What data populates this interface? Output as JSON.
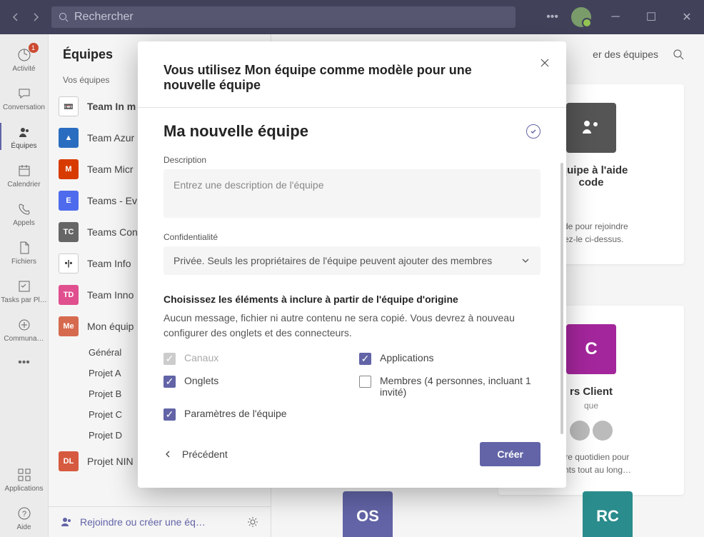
{
  "titlebar": {
    "search_placeholder": "Rechercher"
  },
  "rail": {
    "items": [
      {
        "label": "Activité",
        "name": "activity",
        "badge": "1"
      },
      {
        "label": "Conversation",
        "name": "chat"
      },
      {
        "label": "Équipes",
        "name": "teams",
        "active": true
      },
      {
        "label": "Calendrier",
        "name": "calendar"
      },
      {
        "label": "Appels",
        "name": "calls"
      },
      {
        "label": "Fichiers",
        "name": "files"
      },
      {
        "label": "Tasks par Pl…",
        "name": "tasks"
      },
      {
        "label": "Communa…",
        "name": "communa"
      }
    ],
    "apps": "Applications",
    "help": "Aide"
  },
  "panel": {
    "header": "Équipes",
    "sub": "Vos équipes",
    "teams": [
      {
        "label": "Team In m",
        "avatar": "📼",
        "color": "#fff",
        "bold": true
      },
      {
        "label": "Team Azur",
        "avatar": "▲",
        "color": "#2a6dc0"
      },
      {
        "label": "Team Micr",
        "avatar": "M",
        "color": "#d83b01"
      },
      {
        "label": "Teams - Ev",
        "avatar": "E",
        "color": "#4f6bed"
      },
      {
        "label": "Teams Con",
        "avatar": "TC",
        "color": "#666"
      },
      {
        "label": "Team Info",
        "avatar": "•|•",
        "color": "#fff"
      },
      {
        "label": "Team Inno",
        "avatar": "TD",
        "color": "#e04f8e"
      },
      {
        "label": "Mon équip",
        "avatar": "Me",
        "color": "#d66a4f"
      }
    ],
    "channels": [
      "Général",
      "Projet A",
      "Projet B",
      "Projet C",
      "Projet D"
    ],
    "extra_team": {
      "label": "Projet NIN",
      "avatar": "DL",
      "color": "#d65a3f"
    },
    "footer": "Rejoindre ou créer une éq…"
  },
  "content": {
    "manage": "er des équipes",
    "card1": {
      "title": "équipe à l'aide\ncode",
      "desc": "code pour rejoindre\ntrez-le ci-dessus."
    },
    "card2": {
      "avatar": "C",
      "title": "rs Client",
      "sub": "que",
      "desc": "notre quotidien pour\nclients tout au long…"
    },
    "card3": {
      "avatar": "OS",
      "color": "#6264a7"
    },
    "card4": {
      "avatar": "RC",
      "color": "#2a8c8c"
    }
  },
  "modal": {
    "title": "Vous utilisez Mon équipe comme modèle pour une nouvelle équipe",
    "team_name": "Ma nouvelle équipe",
    "desc_label": "Description",
    "desc_placeholder": "Entrez une description de l'équipe",
    "priv_label": "Confidentialité",
    "priv_value": "Privée. Seuls les propriétaires de l'équipe peuvent ajouter des membres",
    "section_h": "Choisissez les éléments à inclure à partir de l'équipe d'origine",
    "section_p": "Aucun message, fichier ni autre contenu ne sera copié. Vous devrez à nouveau configurer des onglets et des connecteurs.",
    "cb": {
      "canaux": "Canaux",
      "onglets": "Onglets",
      "params": "Paramètres de l'équipe",
      "apps": "Applications",
      "membres": "Membres (4 personnes, incluant 1 invité)"
    },
    "back": "Précédent",
    "create": "Créer"
  }
}
